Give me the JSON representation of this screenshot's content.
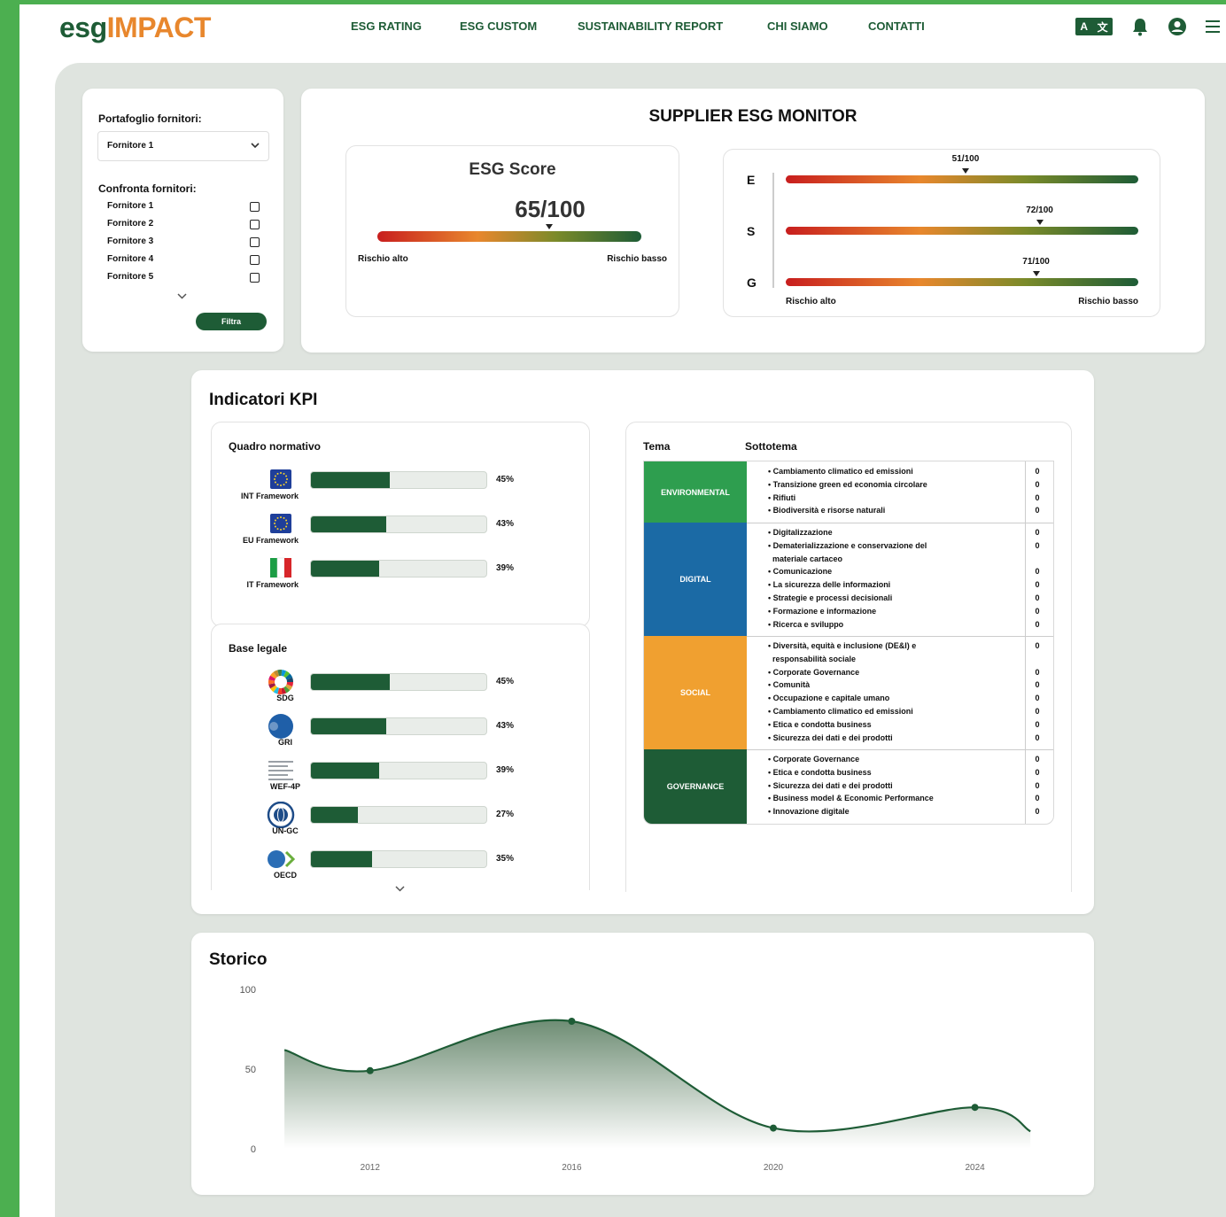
{
  "logo": {
    "part1": "esg",
    "part2": "IMPACT"
  },
  "nav": {
    "items": [
      "ESG RATING",
      "ESG CUSTOM",
      "SUSTAINABILITY REPORT",
      "CHI SIAMO",
      "CONTATTI"
    ]
  },
  "header": {
    "lang_a": "A",
    "lang_b": "文",
    "icons": [
      "translate-icon",
      "bell-icon",
      "user-icon",
      "menu-icon"
    ]
  },
  "filters": {
    "portfolio_label": "Portafoglio fornitori:",
    "selected": "Fornitore 1",
    "compare_label": "Confronta fornitori:",
    "suppliers": [
      "Fornitore 1",
      "Fornitore 2",
      "Fornitore 3",
      "Fornitore 4",
      "Fornitore 5"
    ],
    "filter_button": "Filtra"
  },
  "monitor": {
    "title": "SUPPLIER ESG MONITOR",
    "score_title": "ESG Score",
    "score": 65,
    "score_text": "65/100",
    "risk_high": "Rischio alto",
    "risk_low": "Rischio basso",
    "pillars": [
      {
        "letter": "E",
        "value": 51,
        "text": "51/100"
      },
      {
        "letter": "S",
        "value": 72,
        "text": "72/100"
      },
      {
        "letter": "G",
        "value": 71,
        "text": "71/100"
      }
    ]
  },
  "kpi": {
    "title": "Indicatori KPI",
    "normative_title": "Quadro normativo",
    "normative": [
      {
        "label": "INT Framework",
        "pct": 45,
        "pct_text": "45%"
      },
      {
        "label": "EU Framework",
        "pct": 43,
        "pct_text": "43%"
      },
      {
        "label": "IT Framework",
        "pct": 39,
        "pct_text": "39%"
      }
    ],
    "legal_title": "Base legale",
    "legal": [
      {
        "label": "SDG",
        "pct": 45,
        "pct_text": "45%"
      },
      {
        "label": "GRI",
        "pct": 43,
        "pct_text": "43%"
      },
      {
        "label": "WEF-4P",
        "pct": 39,
        "pct_text": "39%"
      },
      {
        "label": "UN-GC",
        "pct": 27,
        "pct_text": "27%"
      },
      {
        "label": "OECD",
        "pct": 35,
        "pct_text": "35%"
      }
    ],
    "table_headers": {
      "theme": "Tema",
      "subtheme": "Sottotema"
    },
    "themes": [
      {
        "name": "ENVIRONMENTAL",
        "color": "#2e9e4f",
        "items": [
          "Cambiamento climatico ed emissioni",
          "Transizione green ed economia circolare",
          "Rifiuti",
          "Biodiversità e risorse naturali"
        ],
        "zeros": [
          "0",
          "0",
          "0",
          "0"
        ]
      },
      {
        "name": "DIGITAL",
        "color": "#1b6aa5",
        "items": [
          "Digitalizzazione",
          "Dematerializzazione e conservazione del",
          "materiale cartaceo",
          "Comunicazione",
          "La sicurezza delle informazioni",
          "Strategie e processi decisionali",
          "Formazione e informazione",
          "Ricerca e sviluppo"
        ],
        "zeros": [
          "0",
          "0",
          "",
          "0",
          "0",
          "0",
          "0",
          "0"
        ]
      },
      {
        "name": "SOCIAL",
        "color": "#f0a030",
        "items": [
          "Diversità, equità e inclusione (DE&I) e",
          "responsabilità sociale",
          "Corporate Governance",
          "Comunità",
          "Occupazione e capitale umano",
          "Cambiamento climatico ed emissioni",
          "Etica e condotta business",
          "Sicurezza dei dati e dei prodotti"
        ],
        "zeros": [
          "0",
          "",
          "0",
          "0",
          "0",
          "0",
          "0",
          "0"
        ]
      },
      {
        "name": "GOVERNANCE",
        "color": "#1e5c36",
        "items": [
          "Corporate Governance",
          "Etica e condotta business",
          "Sicurezza dei dati e dei prodotti",
          "Business model & Economic Performance",
          "Innovazione digitale"
        ],
        "zeros": [
          "0",
          "0",
          "0",
          "0",
          "0"
        ]
      }
    ]
  },
  "history": {
    "title": "Storico",
    "y_ticks": [
      "100",
      "50",
      "0"
    ],
    "x_ticks": [
      "2012",
      "2016",
      "2020",
      "2024"
    ]
  },
  "chart_data": {
    "type": "area",
    "x": [
      2010.3,
      2012,
      2016,
      2020,
      2024,
      2025.1
    ],
    "values": [
      62,
      49,
      80,
      13,
      26,
      11
    ],
    "markers": [
      {
        "x": 2012,
        "y": 49
      },
      {
        "x": 2016,
        "y": 80
      },
      {
        "x": 2020,
        "y": 13
      },
      {
        "x": 2024,
        "y": 26
      }
    ],
    "ylim": [
      0,
      100
    ],
    "xlim": [
      2010,
      2025.5
    ],
    "color": "#1e5c36"
  }
}
